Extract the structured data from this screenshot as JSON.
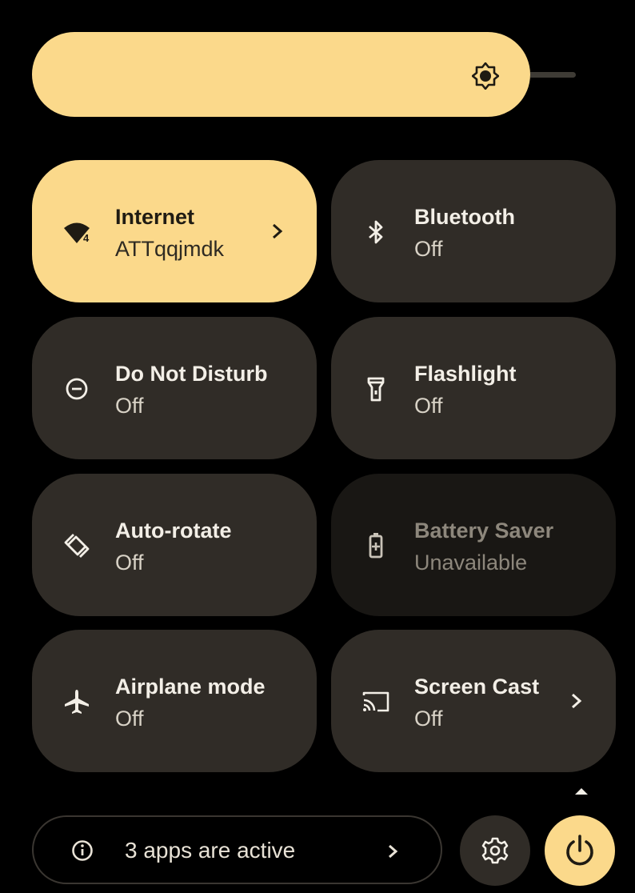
{
  "brightness": {
    "level": 0.79,
    "icon": "brightness-icon"
  },
  "tiles": [
    {
      "title": "Internet",
      "subtitle": "ATTqqjmdk",
      "icon": "wifi-icon",
      "state": "on",
      "has_chevron": true
    },
    {
      "title": "Bluetooth",
      "subtitle": "Off",
      "icon": "bluetooth-icon",
      "state": "off"
    },
    {
      "title": "Do Not Disturb",
      "subtitle": "Off",
      "icon": "do-not-disturb-icon",
      "state": "off"
    },
    {
      "title": "Flashlight",
      "subtitle": "Off",
      "icon": "flashlight-icon",
      "state": "off"
    },
    {
      "title": "Auto-rotate",
      "subtitle": "Off",
      "icon": "auto-rotate-icon",
      "state": "off"
    },
    {
      "title": "Battery Saver",
      "subtitle": "Unavailable",
      "icon": "battery-saver-icon",
      "state": "unavailable"
    },
    {
      "title": "Airplane mode",
      "subtitle": "Off",
      "icon": "airplane-icon",
      "state": "off"
    },
    {
      "title": "Screen Cast",
      "subtitle": "Off",
      "icon": "screen-cast-icon",
      "state": "off",
      "has_chevron": true
    }
  ],
  "wifi_badge": "4",
  "footer": {
    "active_apps_label": "3 apps are active",
    "info_icon": "info-icon",
    "settings_icon": "gear-icon",
    "power_icon": "power-icon"
  },
  "colors": {
    "accent": "#fbd98b",
    "tile_off": "#302c27",
    "tile_unavailable": "#191714",
    "background": "#000000"
  }
}
